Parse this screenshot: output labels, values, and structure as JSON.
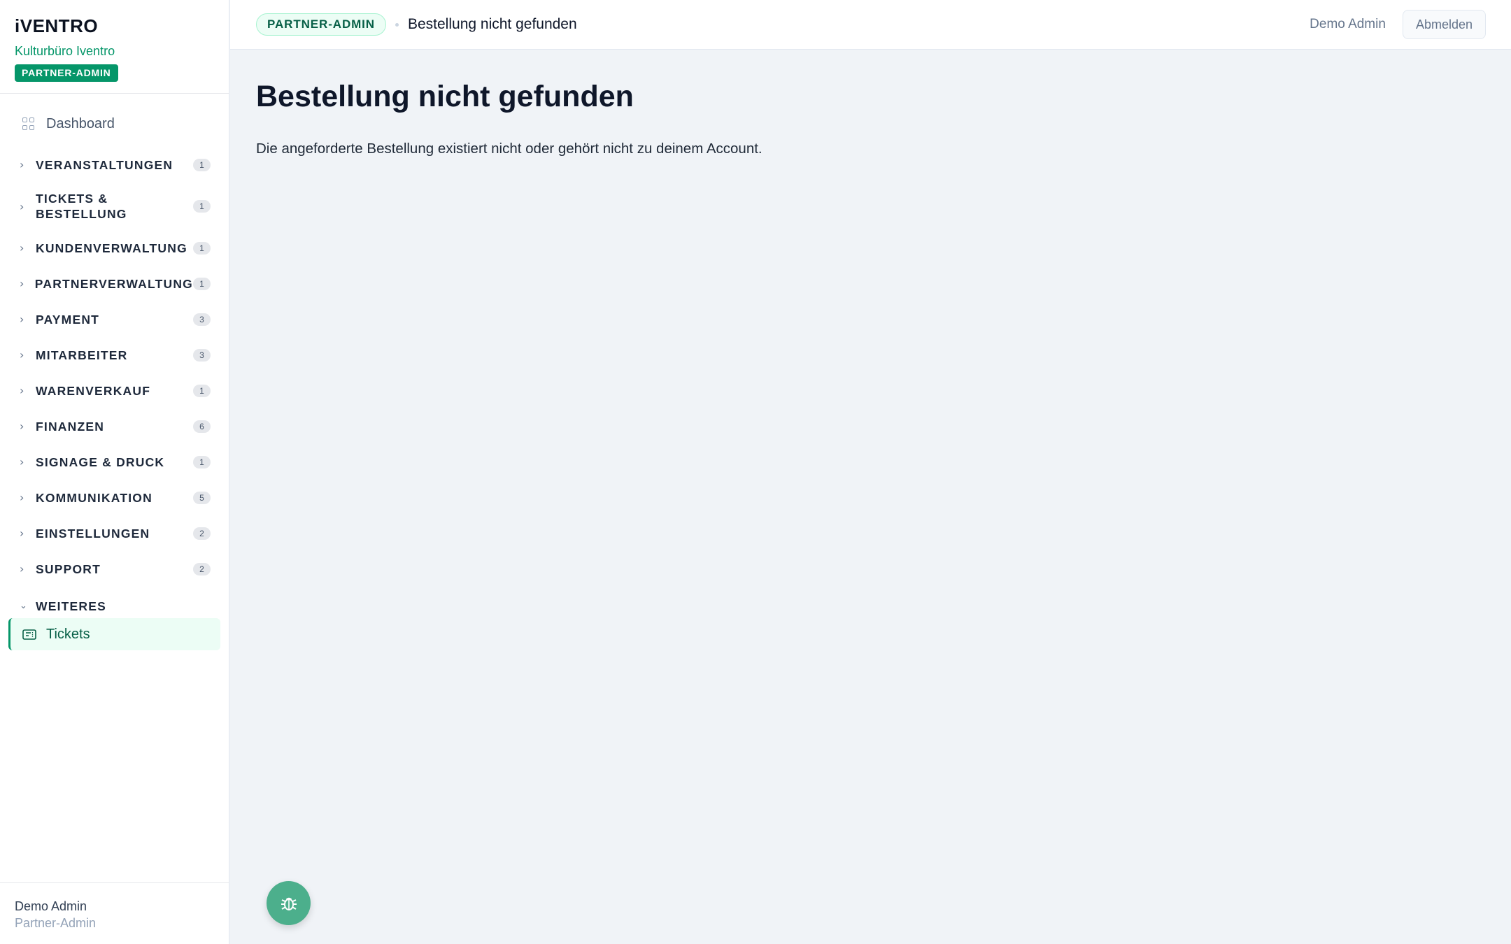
{
  "brand": {
    "logo": "iVENTRO",
    "org": "Kulturbüro Iventro",
    "role_badge": "PARTNER-ADMIN"
  },
  "nav": {
    "dashboard": "Dashboard",
    "sections": [
      {
        "label": "VERANSTALTUNGEN",
        "count": "1"
      },
      {
        "label": "TICKETS & BESTELLUNG",
        "count": "1"
      },
      {
        "label": "KUNDENVERWALTUNG",
        "count": "1"
      },
      {
        "label": "PARTNERVERWALTUNG",
        "count": "1"
      },
      {
        "label": "PAYMENT",
        "count": "3"
      },
      {
        "label": "MITARBEITER",
        "count": "3"
      },
      {
        "label": "WARENVERKAUF",
        "count": "1"
      },
      {
        "label": "FINANZEN",
        "count": "6"
      },
      {
        "label": "SIGNAGE & DRUCK",
        "count": "1"
      },
      {
        "label": "KOMMUNIKATION",
        "count": "5"
      },
      {
        "label": "EINSTELLUNGEN",
        "count": "2"
      },
      {
        "label": "SUPPORT",
        "count": "2"
      }
    ],
    "expanded_section": "WEITERES",
    "active_item": "Tickets"
  },
  "footer": {
    "name": "Demo Admin",
    "role": "Partner-Admin"
  },
  "header": {
    "role_pill": "PARTNER-ADMIN",
    "breadcrumb": "Bestellung nicht gefunden",
    "user": "Demo Admin",
    "logout": "Abmelden"
  },
  "main": {
    "title": "Bestellung nicht gefunden",
    "message": "Die angeforderte Bestellung existiert nicht oder gehört nicht zu deinem Account."
  },
  "fab": {
    "icon": "bug-icon"
  },
  "colors": {
    "accent": "#059669",
    "background": "#f0f3f7",
    "fab": "#4caf8c"
  }
}
